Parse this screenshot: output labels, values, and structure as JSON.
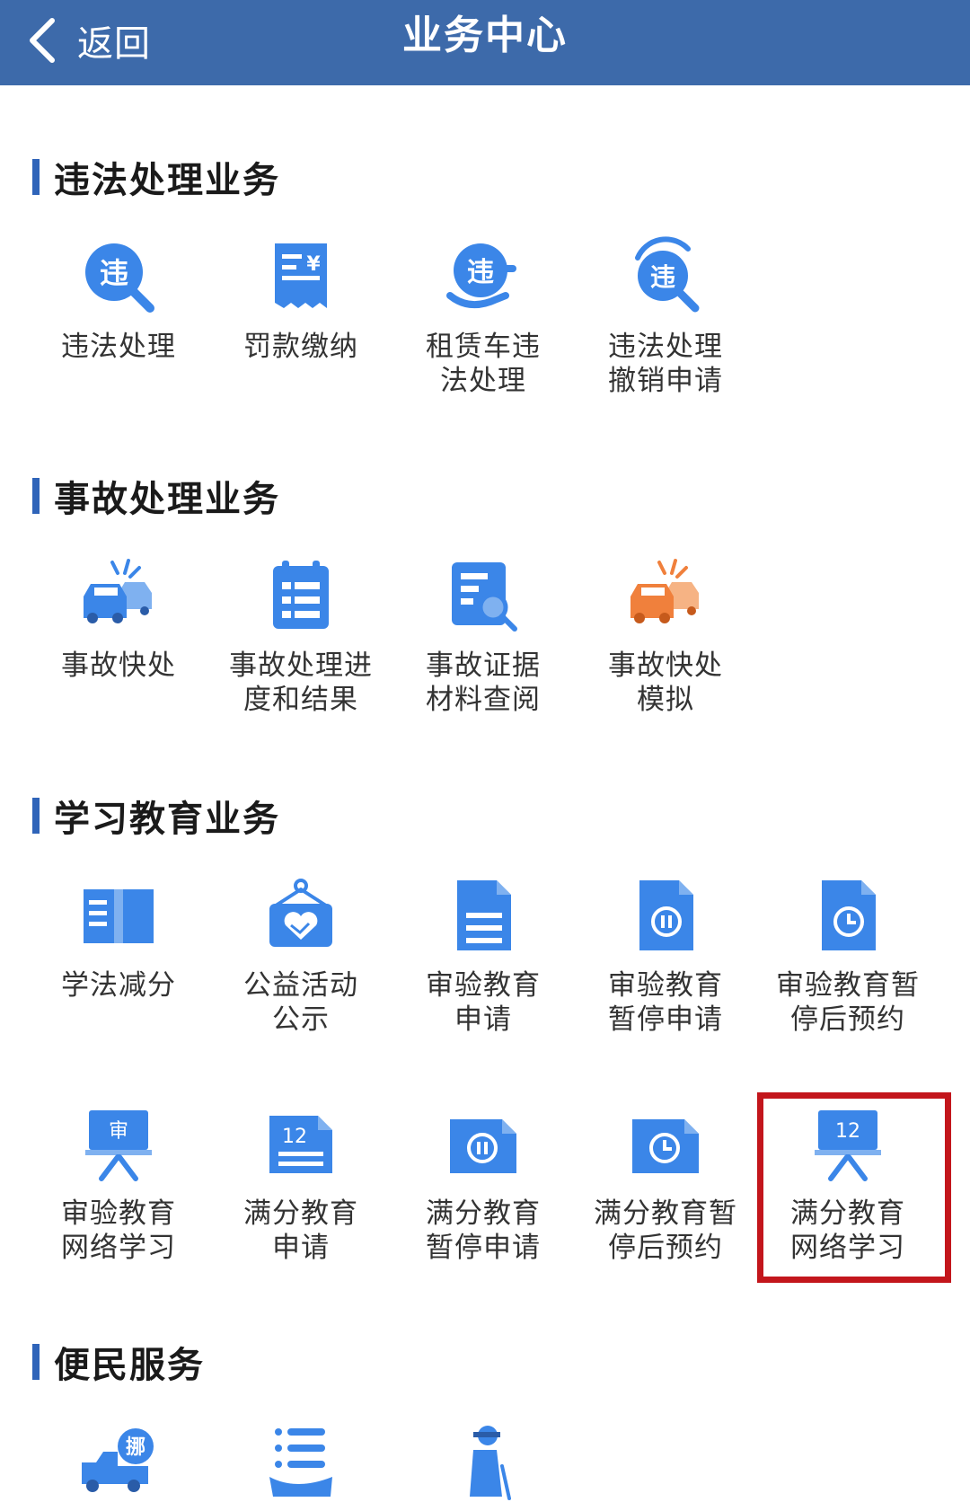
{
  "header": {
    "back_label": "返回",
    "title": "业务中心"
  },
  "colors": {
    "header_bg": "#3d6aaa",
    "accent": "#2f64b9",
    "icon_blue": "#3b86e8",
    "icon_orange": "#f0803c",
    "highlight": "#c3161c"
  },
  "sections": [
    {
      "title": "违法处理业务",
      "items": [
        {
          "label": "违法处理",
          "icon": "violation-search-icon"
        },
        {
          "label": "罚款缴纳",
          "icon": "fine-receipt-icon"
        },
        {
          "label": "租赁车违\n法处理",
          "icon": "rental-violation-icon"
        },
        {
          "label": "违法处理\n撤销申请",
          "icon": "violation-revoke-icon"
        }
      ]
    },
    {
      "title": "事故处理业务",
      "items": [
        {
          "label": "事故快处",
          "icon": "car-crash-icon"
        },
        {
          "label": "事故处理进\n度和结果",
          "icon": "clipboard-list-icon"
        },
        {
          "label": "事故证据\n材料查阅",
          "icon": "document-search-icon"
        },
        {
          "label": "事故快处\n模拟",
          "icon": "car-crash-orange-icon"
        }
      ]
    },
    {
      "title": "学习教育业务",
      "items": [
        {
          "label": "学法减分",
          "icon": "open-book-icon"
        },
        {
          "label": "公益活动\n公示",
          "icon": "charity-heart-icon"
        },
        {
          "label": "审验教育\n申请",
          "icon": "document-lines-icon"
        },
        {
          "label": "审验教育\n暂停申请",
          "icon": "document-pause-icon"
        },
        {
          "label": "审验教育暂\n停后预约",
          "icon": "document-clock-icon"
        },
        {
          "label": "审验教育\n网络学习",
          "icon": "board-shen-icon",
          "badge": "审"
        },
        {
          "label": "满分教育\n申请",
          "icon": "document-12-icon",
          "badge": "12"
        },
        {
          "label": "满分教育\n暂停申请",
          "icon": "card-pause-icon"
        },
        {
          "label": "满分教育暂\n停后预约",
          "icon": "card-clock-icon"
        },
        {
          "label": "满分教育\n网络学习",
          "icon": "board-12-icon",
          "badge": "12",
          "highlighted": true
        }
      ]
    },
    {
      "title": "便民服务",
      "items": [
        {
          "label": "",
          "icon": "tow-truck-icon",
          "badge": "挪"
        },
        {
          "label": "",
          "icon": "list-hand-icon"
        },
        {
          "label": "",
          "icon": "elderly-person-icon"
        }
      ]
    }
  ]
}
